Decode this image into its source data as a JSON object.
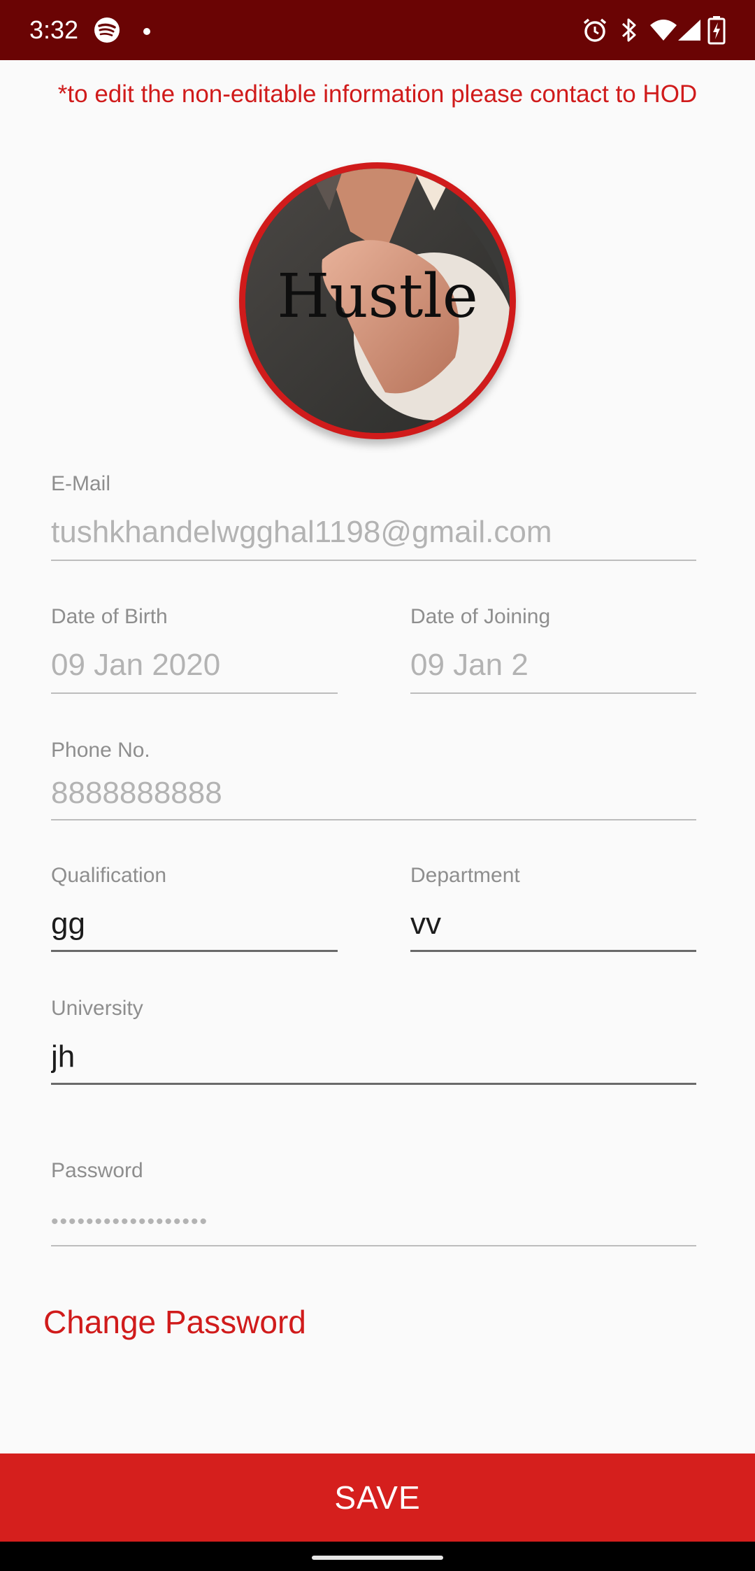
{
  "status_bar": {
    "time": "3:32",
    "left_icons": [
      "spotify-icon",
      "notification-dot-icon"
    ],
    "right_icons": [
      "alarm-icon",
      "bluetooth-icon",
      "wifi-icon",
      "signal-icon",
      "battery-charging-icon"
    ],
    "background_color": "#6a0404"
  },
  "notice": "*to edit the non-editable information please contact to HOD",
  "avatar": {
    "image_text": "Hustle",
    "border_color": "#d01b1b"
  },
  "fields": {
    "email": {
      "label": "E-Mail",
      "value": "tushkhandelwgghal1198@gmail.com",
      "editable": false
    },
    "dob": {
      "label": "Date of Birth",
      "value": "09 Jan 2020",
      "editable": false
    },
    "doj": {
      "label": "Date of Joining",
      "value": "09 Jan 2",
      "editable": false
    },
    "phone": {
      "label": "Phone No.",
      "value": "8888888888",
      "editable": false
    },
    "qualification": {
      "label": "Qualification",
      "value": "gg",
      "editable": true
    },
    "department": {
      "label": "Department",
      "value": "vv",
      "editable": true
    },
    "university": {
      "label": "University",
      "value": "jh",
      "editable": true
    },
    "password": {
      "label": "Password",
      "value": "••••••••••••••••••",
      "editable": false
    }
  },
  "change_password_label": "Change Password",
  "save_label": "SAVE",
  "colors": {
    "accent": "#d01b1b",
    "save_button": "#d51f1d",
    "readonly_text": "#b3b3b3",
    "label_text": "#8e8e8e"
  }
}
